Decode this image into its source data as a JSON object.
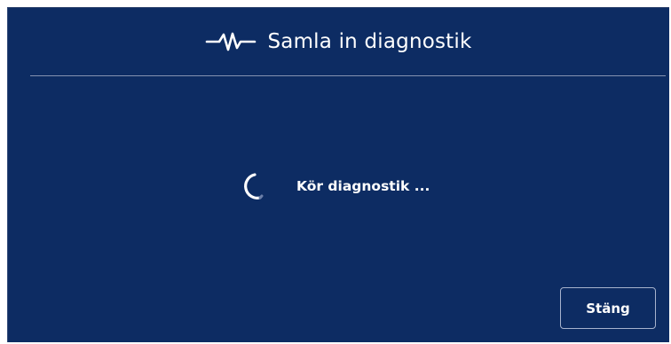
{
  "dialog": {
    "title": "Samla in diagnostik",
    "title_icon": "pulse-icon",
    "status_text": "Kör diagnostik ...",
    "status_icon": "spinner-icon",
    "close_label": "Stäng"
  },
  "colors": {
    "background": "#0d2c63",
    "text": "#ffffff",
    "divider": "#8592b1",
    "button_border": "#a7b3cd"
  }
}
